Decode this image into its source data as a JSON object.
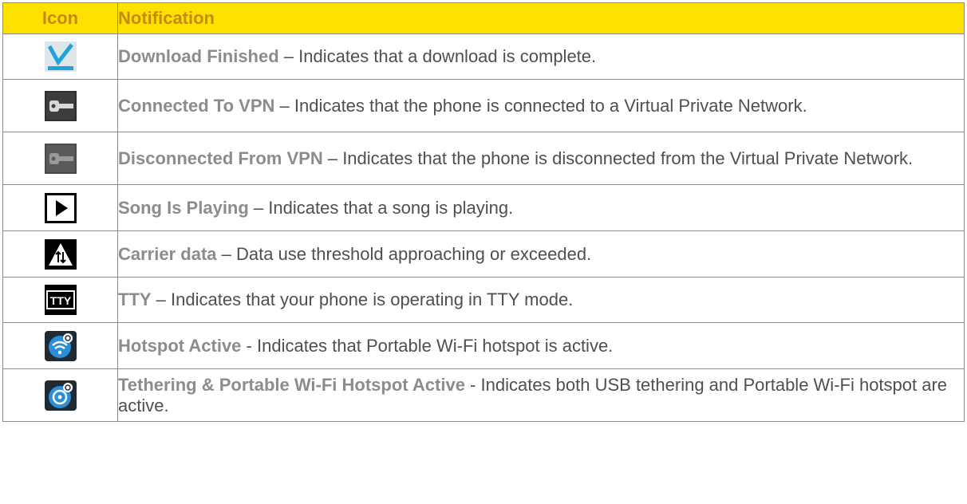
{
  "header": {
    "icon": "Icon",
    "notification": "Notification"
  },
  "rows": [
    {
      "icon": "download-finished-icon",
      "term": "Download Finished",
      "sep": " – ",
      "desc": "Indicates that a download is complete."
    },
    {
      "icon": "vpn-connected-icon",
      "term": "Connected To VPN",
      "sep": " – ",
      "desc": "Indicates that the phone is connected to a Virtual Private Network."
    },
    {
      "icon": "vpn-disconnected-icon",
      "term": "Disconnected From VPN",
      "sep": " – ",
      "desc": "Indicates that the phone is disconnected from the Virtual Private Network."
    },
    {
      "icon": "play-icon",
      "term": "Song Is Playing",
      "sep": " – ",
      "desc": "Indicates that a song is playing."
    },
    {
      "icon": "carrier-data-warning-icon",
      "term": "Carrier data",
      "sep": " – ",
      "desc": "Data use threshold approaching or exceeded."
    },
    {
      "icon": "tty-icon",
      "term": "TTY",
      "sep": " – ",
      "desc": "Indicates that your phone is operating in TTY mode."
    },
    {
      "icon": "hotspot-active-icon",
      "term": "Hotspot Active",
      "sep": " - ",
      "desc": "Indicates that Portable Wi-Fi hotspot is active."
    },
    {
      "icon": "tethering-hotspot-active-icon",
      "term": "Tethering & Portable Wi-Fi Hotspot Active",
      "sep": " - ",
      "desc": "Indicates both USB tethering and Portable Wi-Fi hotspot are active."
    }
  ],
  "icon_text": {
    "tty": "TTY"
  },
  "colors": {
    "header_bg": "#ffe100",
    "header_text": "#c58a13",
    "term_text": "#8c8c8c",
    "body_text": "#4f4f4f",
    "check_blue": "#1fa3d9"
  }
}
